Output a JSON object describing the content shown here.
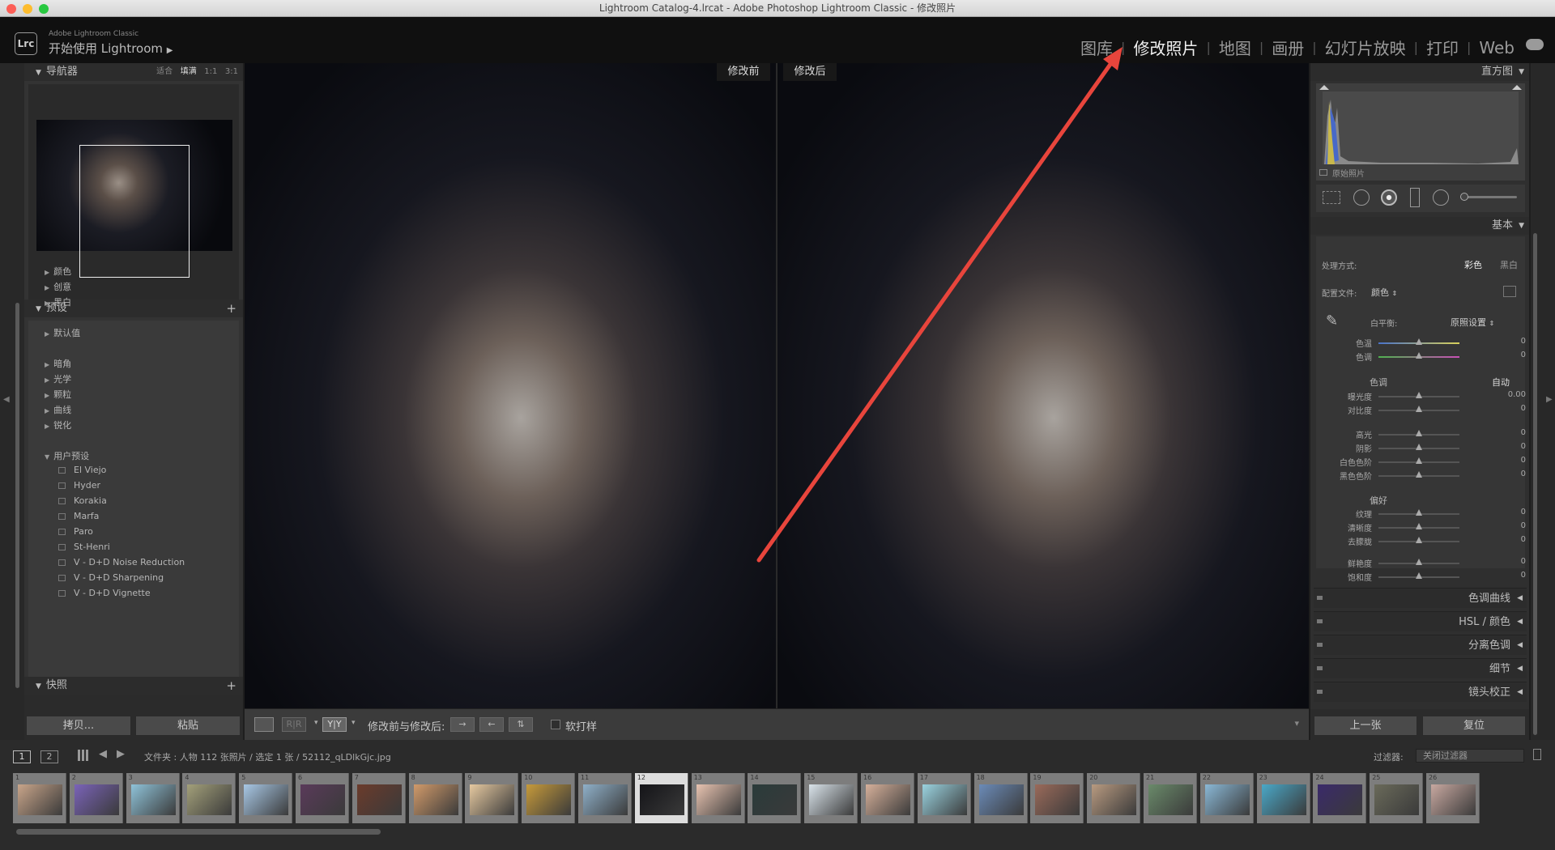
{
  "window": {
    "title": "Lightroom Catalog-4.lrcat - Adobe Photoshop Lightroom Classic - 修改照片"
  },
  "brand": {
    "logo": "Lrc",
    "small": "Adobe Lightroom Classic",
    "main": "开始使用 Lightroom"
  },
  "modules": [
    "图库",
    "修改照片",
    "地图",
    "画册",
    "幻灯片放映",
    "打印",
    "Web"
  ],
  "active_module": "修改照片",
  "navigator": {
    "title": "导航器",
    "zoom": [
      "适合",
      "填满",
      "1:1",
      "3:1"
    ]
  },
  "presets": {
    "title": "预设",
    "add": "+",
    "groups_a": [
      "颜色",
      "创意",
      "黑白"
    ],
    "default": "默认值",
    "groups_b": [
      "暗角",
      "光学",
      "颗粒",
      "曲线",
      "锐化"
    ],
    "user_group": "用户预设",
    "user_items": [
      "El Viejo",
      "Hyder",
      "Korakia",
      "Marfa",
      "Paro",
      "St-Henri",
      "V - D+D Noise Reduction",
      "V - D+D Sharpening",
      "V - D+D Vignette"
    ]
  },
  "snapshots": {
    "title": "快照",
    "add": "+"
  },
  "left_buttons": {
    "copy": "拷贝...",
    "paste": "粘贴"
  },
  "view": {
    "before": "修改前",
    "after": "修改后"
  },
  "toolbar": {
    "compare_label": "修改前与修改后:",
    "softproof": "软打样",
    "yy": "Y|Y"
  },
  "histogram": {
    "title": "直方图",
    "original": "原始照片"
  },
  "basic": {
    "title": "基本",
    "treatment_label": "处理方式:",
    "treatment_color": "彩色",
    "treatment_bw": "黑白",
    "profile_label": "配置文件:",
    "profile_value": "颜色",
    "wb_label": "白平衡:",
    "wb_value": "原照设置",
    "tone_label": "色调",
    "tone_auto": "自动",
    "presence_label": "偏好",
    "wb_sliders": [
      {
        "label": "色温",
        "value": "0"
      },
      {
        "label": "色调",
        "value": "0"
      }
    ],
    "tone_sliders_a": [
      {
        "label": "曝光度",
        "value": "0.00"
      },
      {
        "label": "对比度",
        "value": "0"
      }
    ],
    "tone_sliders_b": [
      {
        "label": "高光",
        "value": "0"
      },
      {
        "label": "阴影",
        "value": "0"
      },
      {
        "label": "白色色阶",
        "value": "0"
      },
      {
        "label": "黑色色阶",
        "value": "0"
      }
    ],
    "presence_sliders_a": [
      {
        "label": "纹理",
        "value": "0"
      },
      {
        "label": "清晰度",
        "value": "0"
      },
      {
        "label": "去朦胧",
        "value": "0"
      }
    ],
    "presence_sliders_b": [
      {
        "label": "鲜艳度",
        "value": "0"
      },
      {
        "label": "饱和度",
        "value": "0"
      }
    ]
  },
  "right_panels": [
    "色调曲线",
    "HSL / 颜色",
    "分离色调",
    "细节",
    "镜头校正"
  ],
  "right_buttons": {
    "prev": "上一张",
    "reset": "复位"
  },
  "filmstrip": {
    "page1": "1",
    "page2": "2",
    "info": "文件夹 : 人物   112 张照片 / 选定 1 张 / 52112_qLDlkGjc.jpg",
    "filter_label": "过滤器:",
    "filter_value": "关闭过滤器",
    "numbers": [
      "1",
      "2",
      "3",
      "4",
      "5",
      "6",
      "7",
      "8",
      "9",
      "10",
      "11",
      "12",
      "13",
      "14",
      "15",
      "16",
      "17",
      "18",
      "19",
      "20",
      "21",
      "22",
      "23",
      "24",
      "25",
      "26"
    ],
    "selected": "12"
  },
  "colors": {
    "annotation_arrow": "#e8453c",
    "panel": "#333333",
    "active_text": "#f0f0f0"
  }
}
